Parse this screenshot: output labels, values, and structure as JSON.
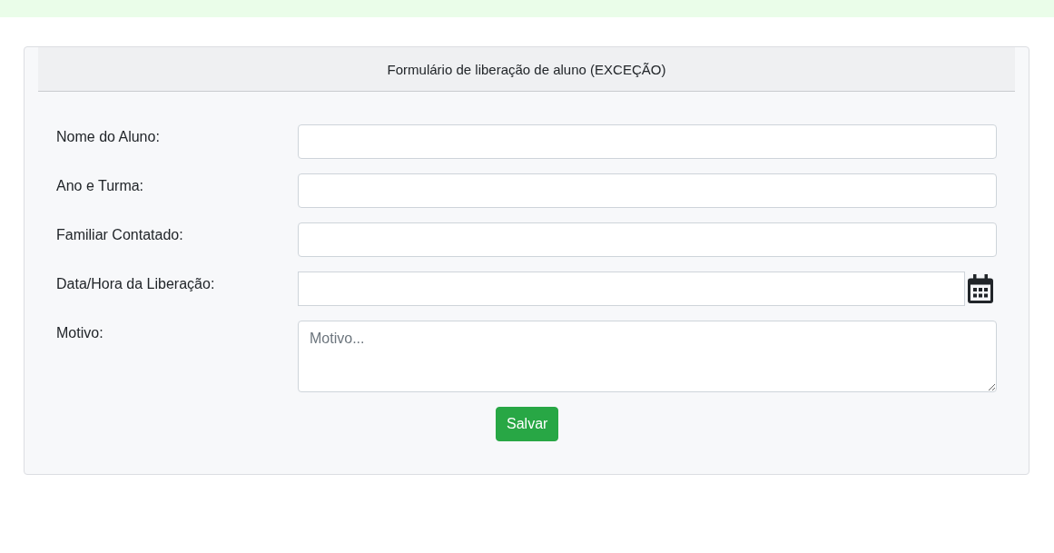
{
  "form": {
    "title": "Formulário de liberação de aluno (EXCEÇÃO)",
    "fields": [
      {
        "kind": "text",
        "label": "Nome do Aluno:"
      },
      {
        "kind": "text",
        "label": "Ano e Turma:"
      },
      {
        "kind": "text",
        "label": "Familiar Contatado:"
      },
      {
        "kind": "datetime",
        "label": "Data/Hora da Liberação:"
      },
      {
        "kind": "textarea",
        "label": "Motivo:",
        "placeholder": "Motivo..."
      }
    ],
    "submit": "Salvar"
  }
}
